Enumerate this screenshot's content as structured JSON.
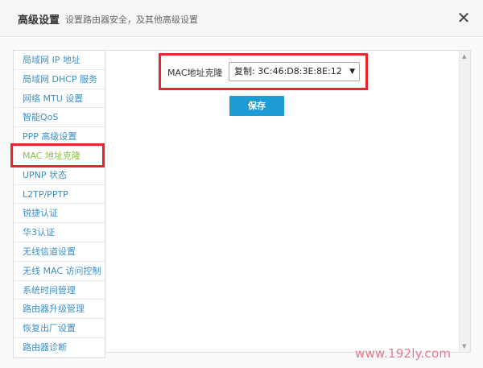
{
  "header": {
    "title": "高级设置",
    "subtitle": "设置路由器安全，及其他高级设置",
    "close_glyph": "✕"
  },
  "sidebar": {
    "items": [
      {
        "label": "局域网 IP 地址"
      },
      {
        "label": "局域网 DHCP 服务"
      },
      {
        "label": "网络 MTU 设置"
      },
      {
        "label": "智能QoS"
      },
      {
        "label": "PPP 高级设置"
      },
      {
        "label": "MAC 地址克隆",
        "active": true
      },
      {
        "label": "UPNP 状态"
      },
      {
        "label": "L2TP/PPTP"
      },
      {
        "label": "锐捷认证"
      },
      {
        "label": "华3认证"
      },
      {
        "label": "无线信道设置"
      },
      {
        "label": "无线 MAC 访问控制"
      },
      {
        "label": "系统时间管理"
      },
      {
        "label": "路由器升级管理"
      },
      {
        "label": "恢复出厂设置"
      },
      {
        "label": "路由器诊断"
      }
    ]
  },
  "mac_clone": {
    "label": "MAC地址克隆",
    "selected": "复制: 3C:46:D8:3E:8E:12",
    "arrow": "▼"
  },
  "buttons": {
    "save_label": "保存"
  },
  "scrollbar": {
    "up": "▲",
    "down": "▼"
  },
  "watermark": {
    "text": "www.192ly.com"
  },
  "colors": {
    "link": "#3b8fc6",
    "active": "#8bc34a",
    "highlight": "#e5262c",
    "button": "#1d9bd3",
    "watermark": "#e87890"
  }
}
